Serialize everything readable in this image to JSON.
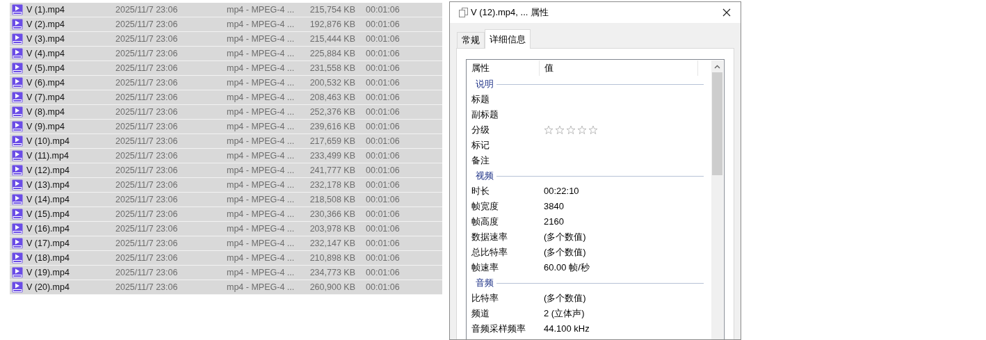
{
  "files": [
    {
      "name": "V (1).mp4",
      "date": "2025/11/7 23:06",
      "type": "mp4 - MPEG-4 ...",
      "size": "215,754 KB",
      "duration": "00:01:06",
      "selected": true
    },
    {
      "name": "V (2).mp4",
      "date": "2025/11/7 23:06",
      "type": "mp4 - MPEG-4 ...",
      "size": "192,876 KB",
      "duration": "00:01:06",
      "selected": true
    },
    {
      "name": "V (3).mp4",
      "date": "2025/11/7 23:06",
      "type": "mp4 - MPEG-4 ...",
      "size": "215,444 KB",
      "duration": "00:01:06",
      "selected": true
    },
    {
      "name": "V (4).mp4",
      "date": "2025/11/7 23:06",
      "type": "mp4 - MPEG-4 ...",
      "size": "225,884 KB",
      "duration": "00:01:06",
      "selected": true
    },
    {
      "name": "V (5).mp4",
      "date": "2025/11/7 23:06",
      "type": "mp4 - MPEG-4 ...",
      "size": "231,558 KB",
      "duration": "00:01:06",
      "selected": true
    },
    {
      "name": "V (6).mp4",
      "date": "2025/11/7 23:06",
      "type": "mp4 - MPEG-4 ...",
      "size": "200,532 KB",
      "duration": "00:01:06",
      "selected": true
    },
    {
      "name": "V (7).mp4",
      "date": "2025/11/7 23:06",
      "type": "mp4 - MPEG-4 ...",
      "size": "208,463 KB",
      "duration": "00:01:06",
      "selected": true
    },
    {
      "name": "V (8).mp4",
      "date": "2025/11/7 23:06",
      "type": "mp4 - MPEG-4 ...",
      "size": "252,376 KB",
      "duration": "00:01:06",
      "selected": true
    },
    {
      "name": "V (9).mp4",
      "date": "2025/11/7 23:06",
      "type": "mp4 - MPEG-4 ...",
      "size": "239,616 KB",
      "duration": "00:01:06",
      "selected": true
    },
    {
      "name": "V (10).mp4",
      "date": "2025/11/7 23:06",
      "type": "mp4 - MPEG-4 ...",
      "size": "217,659 KB",
      "duration": "00:01:06",
      "selected": true
    },
    {
      "name": "V (11).mp4",
      "date": "2025/11/7 23:06",
      "type": "mp4 - MPEG-4 ...",
      "size": "233,499 KB",
      "duration": "00:01:06",
      "selected": true
    },
    {
      "name": "V (12).mp4",
      "date": "2025/11/7 23:06",
      "type": "mp4 - MPEG-4 ...",
      "size": "241,777 KB",
      "duration": "00:01:06",
      "selected": true
    },
    {
      "name": "V (13).mp4",
      "date": "2025/11/7 23:06",
      "type": "mp4 - MPEG-4 ...",
      "size": "232,178 KB",
      "duration": "00:01:06",
      "selected": true
    },
    {
      "name": "V (14).mp4",
      "date": "2025/11/7 23:06",
      "type": "mp4 - MPEG-4 ...",
      "size": "218,508 KB",
      "duration": "00:01:06",
      "selected": true
    },
    {
      "name": "V (15).mp4",
      "date": "2025/11/7 23:06",
      "type": "mp4 - MPEG-4 ...",
      "size": "230,366 KB",
      "duration": "00:01:06",
      "selected": true
    },
    {
      "name": "V (16).mp4",
      "date": "2025/11/7 23:06",
      "type": "mp4 - MPEG-4 ...",
      "size": "203,978 KB",
      "duration": "00:01:06",
      "selected": true
    },
    {
      "name": "V (17).mp4",
      "date": "2025/11/7 23:06",
      "type": "mp4 - MPEG-4 ...",
      "size": "232,147 KB",
      "duration": "00:01:06",
      "selected": true
    },
    {
      "name": "V (18).mp4",
      "date": "2025/11/7 23:06",
      "type": "mp4 - MPEG-4 ...",
      "size": "210,898 KB",
      "duration": "00:01:06",
      "selected": true
    },
    {
      "name": "V (19).mp4",
      "date": "2025/11/7 23:06",
      "type": "mp4 - MPEG-4 ...",
      "size": "234,773 KB",
      "duration": "00:01:06",
      "selected": true
    },
    {
      "name": "V (20).mp4",
      "date": "2025/11/7 23:06",
      "type": "mp4 - MPEG-4 ...",
      "size": "260,900 KB",
      "duration": "00:01:06",
      "selected": true
    }
  ],
  "dialog": {
    "title": "V (12).mp4, ... 属性",
    "tabs": [
      {
        "label": "常规",
        "selected": false
      },
      {
        "label": "详细信息",
        "selected": true
      }
    ],
    "columns": [
      "属性",
      "值"
    ],
    "sections": [
      {
        "title": "说明",
        "rows": [
          {
            "kind": "text",
            "label": "标题"
          },
          {
            "kind": "text",
            "label": "副标题"
          },
          {
            "kind": "stars",
            "label": "分级",
            "stars": 0
          },
          {
            "kind": "text",
            "label": "标记"
          },
          {
            "kind": "text",
            "label": "备注"
          }
        ]
      },
      {
        "title": "视频",
        "rows": [
          {
            "kind": "text",
            "label": "时长",
            "value": "00:22:10"
          },
          {
            "kind": "text",
            "label": "帧宽度",
            "value": "3840"
          },
          {
            "kind": "text",
            "label": "帧高度",
            "value": "2160"
          },
          {
            "kind": "text",
            "label": "数据速率",
            "value": "(多个数值)"
          },
          {
            "kind": "text",
            "label": "总比特率",
            "value": "(多个数值)"
          },
          {
            "kind": "text",
            "label": "帧速率",
            "value": "60.00 帧/秒"
          }
        ]
      },
      {
        "title": "音频",
        "rows": [
          {
            "kind": "text",
            "label": "比特率",
            "value": "(多个数值)"
          },
          {
            "kind": "text",
            "label": "频道",
            "value": "2 (立体声)"
          },
          {
            "kind": "text",
            "label": "音频采样频率",
            "value": "44.100 kHz"
          }
        ]
      }
    ]
  }
}
